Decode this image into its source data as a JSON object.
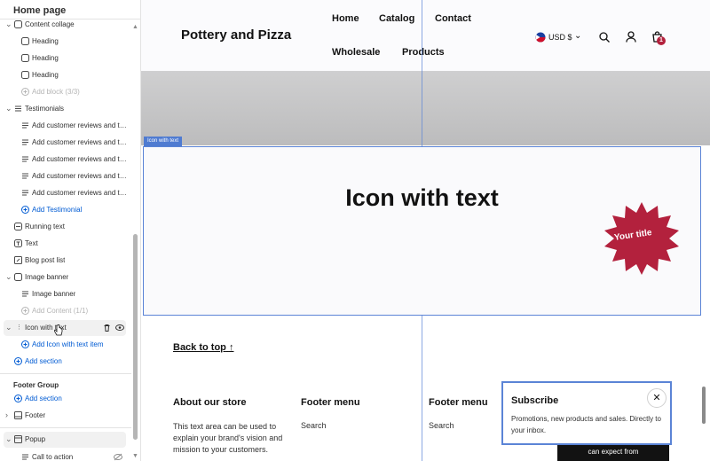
{
  "sidebar": {
    "title": "Home page",
    "items": [
      {
        "label": "Content collage",
        "type": "section"
      },
      {
        "label": "Heading",
        "type": "block"
      },
      {
        "label": "Heading",
        "type": "block"
      },
      {
        "label": "Heading",
        "type": "block"
      },
      {
        "label": "Add block (3/3)",
        "type": "muted"
      },
      {
        "label": "Testimonials",
        "type": "section"
      },
      {
        "label": "Add customer reviews and tes...",
        "type": "block"
      },
      {
        "label": "Add customer reviews and tes...",
        "type": "block"
      },
      {
        "label": "Add customer reviews and tes...",
        "type": "block"
      },
      {
        "label": "Add customer reviews and tes...",
        "type": "block"
      },
      {
        "label": "Add customer reviews and tes...",
        "type": "block"
      },
      {
        "label": "Add Testimonial",
        "type": "add"
      },
      {
        "label": "Running text",
        "type": "section"
      },
      {
        "label": "Text",
        "type": "section"
      },
      {
        "label": "Blog post list",
        "type": "section"
      },
      {
        "label": "Image banner",
        "type": "section"
      },
      {
        "label": "Image banner",
        "type": "block"
      },
      {
        "label": "Add Content (1/1)",
        "type": "muted"
      },
      {
        "label": "Icon with text",
        "type": "section"
      },
      {
        "label": "Add Icon with text item",
        "type": "add"
      },
      {
        "label": "Add section",
        "type": "add"
      }
    ],
    "footer_group": {
      "title": "Footer Group",
      "add_section": "Add section",
      "footer": "Footer"
    },
    "popup": "Popup",
    "call_to_action": "Call to action"
  },
  "store": {
    "brand": "Pottery and Pizza",
    "nav": [
      "Home",
      "Catalog",
      "Contact",
      "Wholesale",
      "Products"
    ],
    "currency": "USD $",
    "cart_count": "1"
  },
  "section_tag": "Icon with text",
  "icon_with_text": {
    "title": "Icon with text",
    "badge": "Your title"
  },
  "back_to_top": "Back to top",
  "footer": {
    "about_title": "About our store",
    "about_text": "This text area can be used to explain your brand's vision and mission to your customers.",
    "menu1_title": "Footer menu",
    "menu1_item": "Search",
    "menu2_title": "Footer menu",
    "menu2_item": "Search"
  },
  "popup": {
    "title": "Subscribe",
    "body": "Promotions, new products and sales. Directly to your inbox.",
    "cta": "can expect from"
  },
  "colors": {
    "accent": "#005bd3",
    "badge": "#b3213d",
    "selection": "#5b84d6"
  }
}
